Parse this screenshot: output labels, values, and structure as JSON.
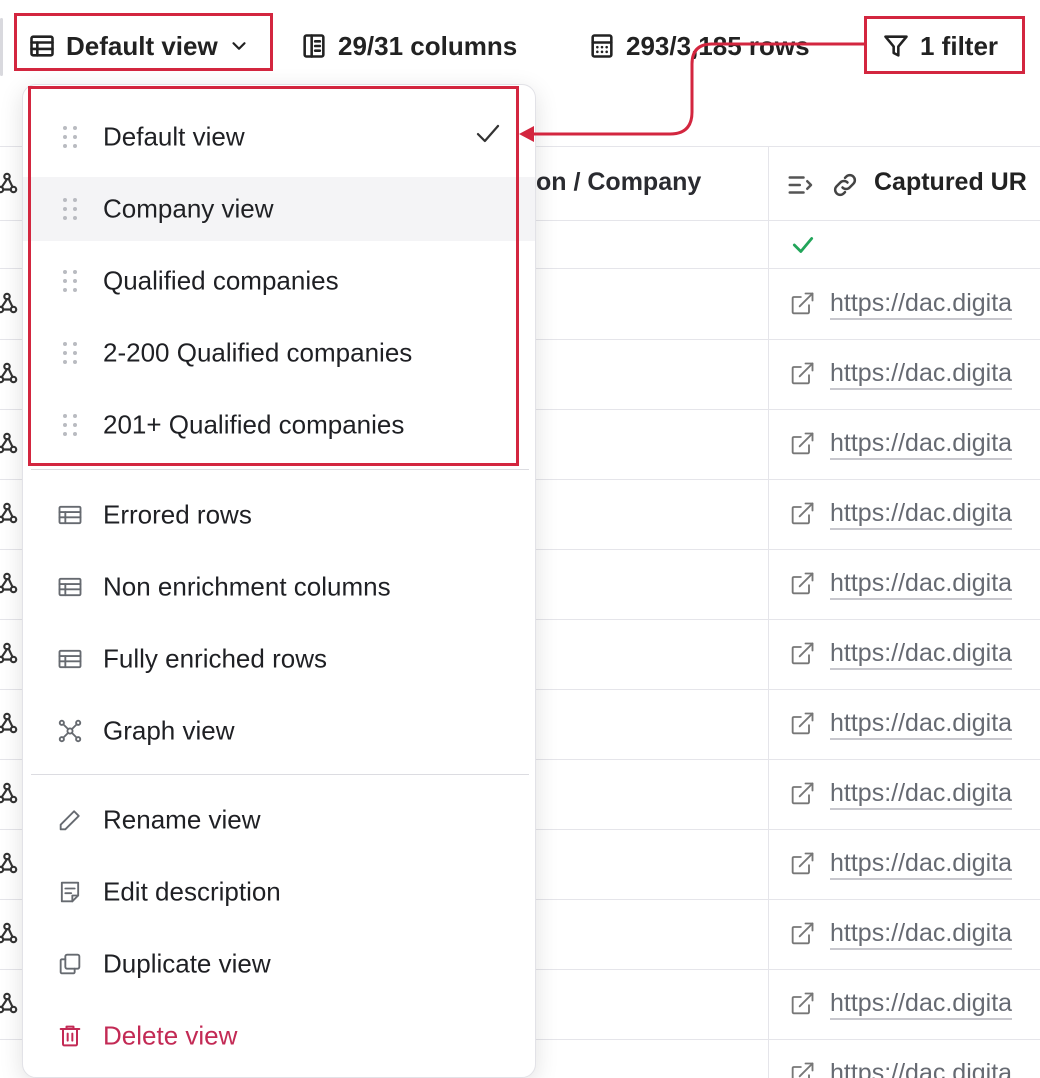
{
  "toolbar": {
    "view_label": "Default view",
    "columns_label": "29/31 columns",
    "rows_label": "293/3,185 rows",
    "filter_label": "1 filter"
  },
  "table": {
    "header_col2": "on / Company",
    "header_col3": "Captured UR",
    "link_text": "https://dac.digita",
    "accent_check_color": "#22a55a"
  },
  "menu": {
    "saved_views": [
      {
        "label": "Default view",
        "selected": true
      },
      {
        "label": "Company view",
        "selected": false
      },
      {
        "label": "Qualified companies",
        "selected": false
      },
      {
        "label": "2-200 Qualified companies",
        "selected": false
      },
      {
        "label": "201+ Qualified companies",
        "selected": false
      }
    ],
    "preset_views": [
      {
        "label": "Errored rows",
        "icon": "table-icon"
      },
      {
        "label": "Non enrichment columns",
        "icon": "table-icon"
      },
      {
        "label": "Fully enriched rows",
        "icon": "table-icon"
      },
      {
        "label": "Graph view",
        "icon": "graph-icon"
      }
    ],
    "actions": [
      {
        "label": "Rename view",
        "icon": "pencil-icon"
      },
      {
        "label": "Edit description",
        "icon": "note-icon"
      },
      {
        "label": "Duplicate view",
        "icon": "duplicate-icon"
      },
      {
        "label": "Delete view",
        "icon": "trash-icon"
      }
    ]
  },
  "colors": {
    "highlight": "#d3263f",
    "danger": "#c32a55"
  }
}
